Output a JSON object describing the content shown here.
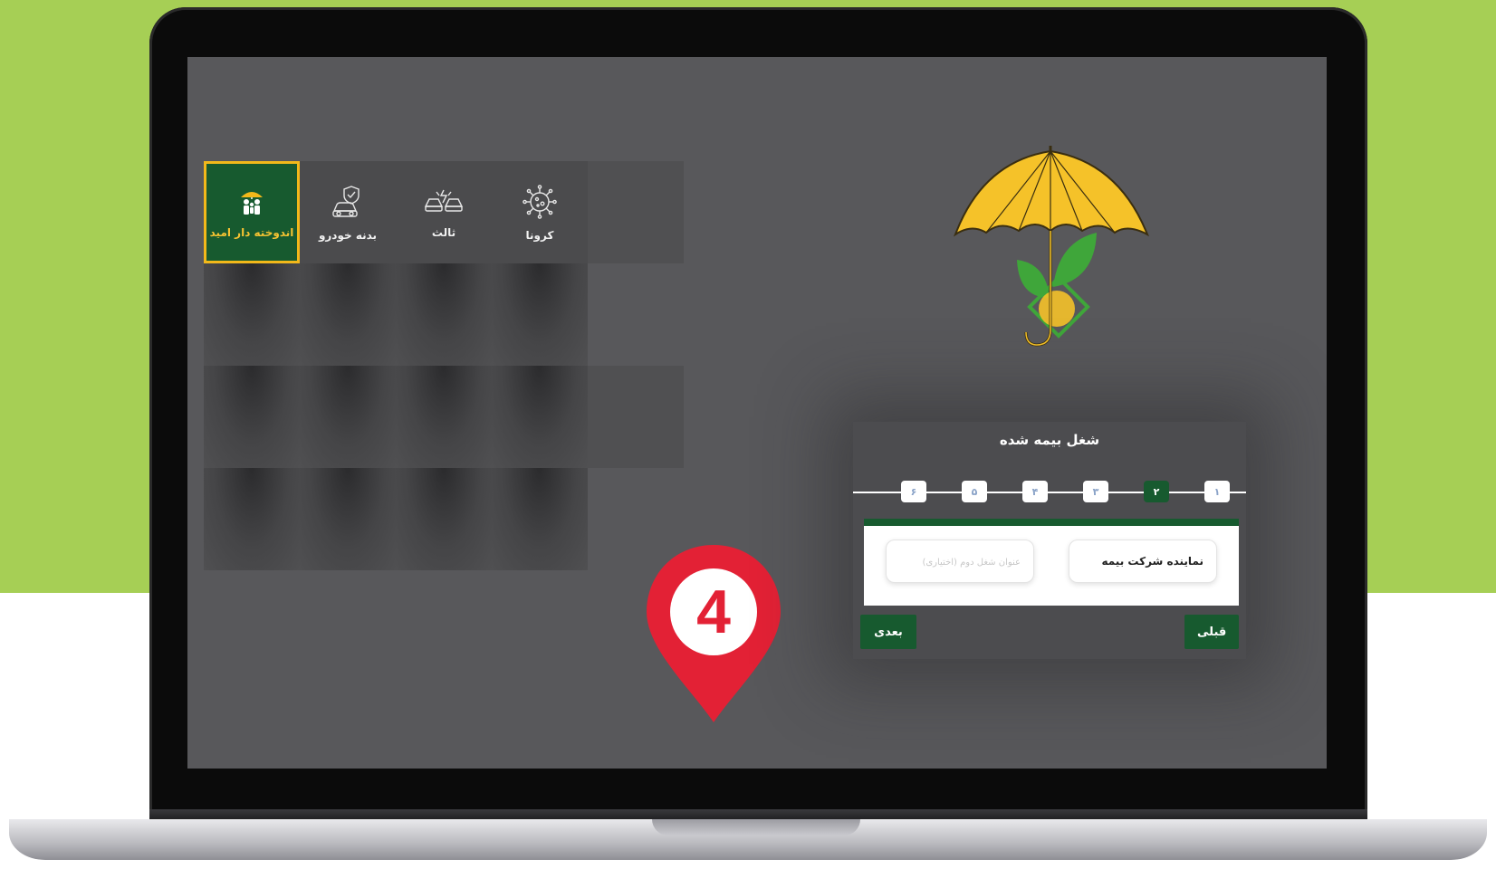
{
  "services": [
    {
      "label": "اندوخته دار امید",
      "icon": "family-umbrella-icon",
      "selected": true
    },
    {
      "label": "بدنه خودرو",
      "icon": "car-shield-icon",
      "selected": false
    },
    {
      "label": "ثالث",
      "icon": "car-crash-icon",
      "selected": false
    },
    {
      "label": "کرونا",
      "icon": "virus-icon",
      "selected": false
    }
  ],
  "form": {
    "title": "شغل بیمه شده",
    "steps": [
      "۱",
      "۲",
      "۳",
      "۴",
      "۵",
      "۶"
    ],
    "active_step": "۲",
    "field_primary_value": "نماینده شرکت بیمه",
    "field_secondary_placeholder": "عنوان شغل دوم (اختیاری)",
    "next_label": "بعدی",
    "prev_label": "قبلی"
  },
  "badge": {
    "number": "4"
  },
  "colors": {
    "background_green": "#a6cf55",
    "screen": "#58585b",
    "brand_green": "#175a2f",
    "highlight": "#f2b81a",
    "pin_red": "#e32135"
  }
}
